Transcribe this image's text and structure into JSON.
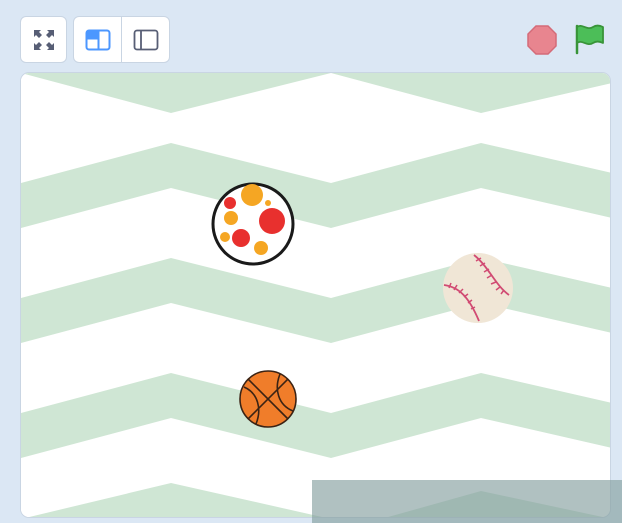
{
  "toolbar": {
    "fullscreen_icon": "fullscreen-icon",
    "small_stage_icon": "small-stage-layout-icon",
    "large_stage_icon": "large-stage-layout-icon",
    "stop_icon": "stop-sign-icon",
    "green_flag_icon": "green-flag-icon"
  },
  "stage": {
    "backdrop": "green zigzag",
    "sprites": [
      "dots-ball",
      "baseball",
      "basketball"
    ]
  },
  "colors": {
    "chrome_background": "#dbe7f4",
    "zigzag_green": "#cfe6d4",
    "stop_red": "#e8858f",
    "flag_green": "#4cbe58",
    "layout_blue": "#4c97ff",
    "basketball_orange": "#f07d2a"
  }
}
